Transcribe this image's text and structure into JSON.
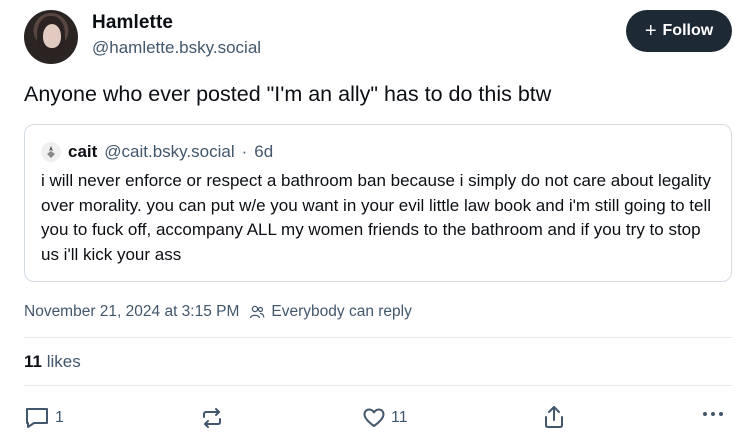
{
  "author": {
    "display_name": "Hamlette",
    "handle": "@hamlette.bsky.social"
  },
  "follow_button": {
    "plus": "+",
    "label": "Follow"
  },
  "post": {
    "text": "Anyone who ever posted \"I'm an ally\" has to do this btw"
  },
  "quote": {
    "name": "cait",
    "handle": "@cait.bsky.social",
    "separator": "·",
    "age": "6d",
    "text": "i will never enforce or respect a bathroom ban because i simply do not care about legality over morality. you can put w/e you want in your evil little law book and i'm still going to tell you to fuck off, accompany ALL my women friends to the bathroom and if you try to stop us i'll kick your ass"
  },
  "meta": {
    "timestamp": "November 21, 2024 at 3:15 PM",
    "reply_setting": "Everybody can reply"
  },
  "stats": {
    "likes_count": "11",
    "likes_label": "likes"
  },
  "actions": {
    "reply_count": "1",
    "like_count": "11"
  },
  "colors": {
    "follow_bg": "#1e2936",
    "muted_text": "#42576c",
    "border": "#d4dbe2"
  },
  "icons": [
    "reply-icon",
    "repost-icon",
    "heart-icon",
    "share-icon",
    "more-icon",
    "people-icon"
  ]
}
